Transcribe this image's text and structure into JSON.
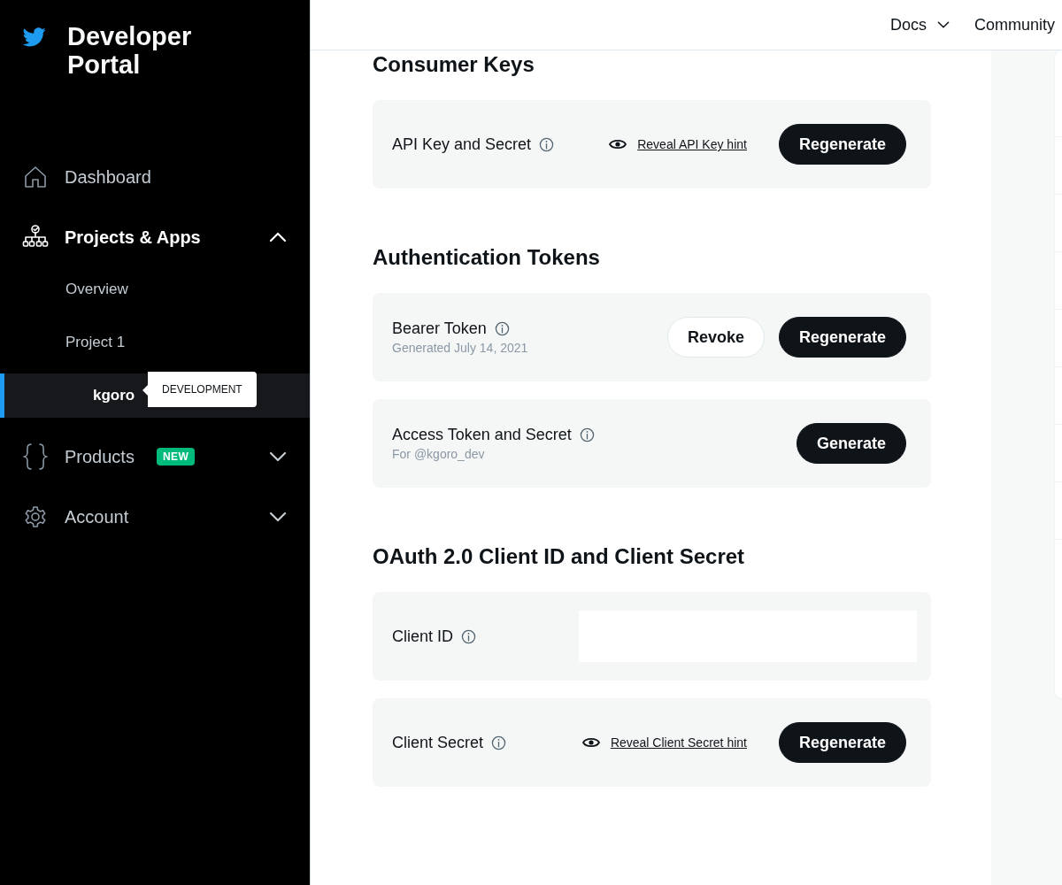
{
  "sidebar": {
    "title": "Developer Portal",
    "items": [
      {
        "label": "Dashboard"
      },
      {
        "label": "Projects & Apps",
        "expanded": true,
        "children": [
          {
            "label": "Overview",
            "selected": false
          },
          {
            "label": "Project 1",
            "selected": false,
            "children": [
              {
                "label": "kgoro",
                "selected": true,
                "tooltip": "DEVELOPMENT"
              }
            ]
          }
        ]
      },
      {
        "label": "Products",
        "badge": "NEW",
        "expanded": false
      },
      {
        "label": "Account",
        "expanded": false
      }
    ]
  },
  "top_nav": [
    {
      "label": "Docs"
    },
    {
      "label": "Community"
    }
  ],
  "sections": [
    {
      "title": "Consumer Keys",
      "rows": [
        {
          "kind": "actions",
          "label": "API Key and Secret",
          "link": "Reveal API Key hint",
          "buttons": [
            {
              "label": "Regenerate",
              "kind": "primary"
            }
          ]
        }
      ]
    },
    {
      "title": "Authentication Tokens",
      "rows": [
        {
          "kind": "actions",
          "label": "Bearer Token",
          "sublabel": "Generated July 14, 2021",
          "buttons": [
            {
              "label": "Revoke",
              "kind": "secondary"
            },
            {
              "label": "Regenerate",
              "kind": "primary"
            }
          ]
        },
        {
          "kind": "actions",
          "label": "Access Token and Secret",
          "sublabel": "For @kgoro_dev",
          "buttons": [
            {
              "label": "Generate",
              "kind": "primary"
            }
          ]
        }
      ]
    },
    {
      "title": "OAuth 2.0 Client ID and Client Secret",
      "rows": [
        {
          "kind": "field",
          "label": "Client ID"
        },
        {
          "kind": "actions",
          "label": "Client Secret",
          "link": "Reveal Client Secret hint",
          "buttons": [
            {
              "label": "Regenerate",
              "kind": "primary"
            }
          ]
        }
      ]
    }
  ]
}
